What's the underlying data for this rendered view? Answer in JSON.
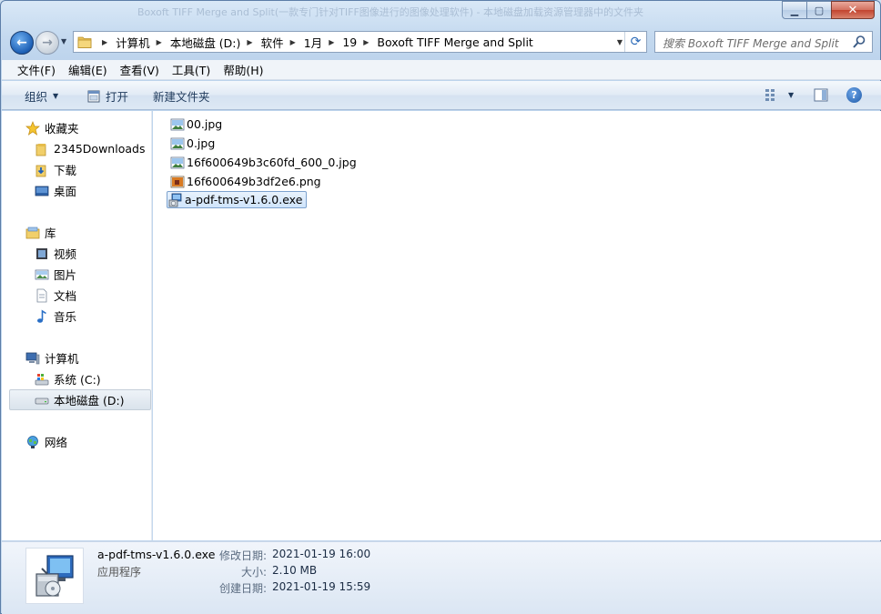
{
  "window": {
    "title": "Boxoft TIFF Merge and Split(一款专门针对TIFF图像进行的图像处理软件) - 本地磁盘加载资源管理器中的文件夹"
  },
  "address": {
    "crumbs": [
      "计算机",
      "本地磁盘 (D:)",
      "软件",
      "1月",
      "19",
      "Boxoft TIFF Merge and Split"
    ]
  },
  "search": {
    "placeholder": "搜索 Boxoft TIFF Merge and Split"
  },
  "menu": {
    "items": [
      "文件(F)",
      "编辑(E)",
      "查看(V)",
      "工具(T)",
      "帮助(H)"
    ]
  },
  "toolbar": {
    "organize_label": "组织",
    "open_label": "打开",
    "newfolder_label": "新建文件夹"
  },
  "sidebar": {
    "favorites": {
      "label": "收藏夹",
      "items": [
        "2345Downloads",
        "下载",
        "桌面"
      ]
    },
    "libraries": {
      "label": "库",
      "items": [
        "视频",
        "图片",
        "文档",
        "音乐"
      ]
    },
    "computer": {
      "label": "计算机",
      "items": [
        "系统 (C:)",
        "本地磁盘 (D:)"
      ]
    },
    "network": {
      "label": "网络"
    }
  },
  "files": [
    {
      "name": "00.jpg",
      "kind": "jpg-icon"
    },
    {
      "name": "0.jpg",
      "kind": "jpg-icon"
    },
    {
      "name": "16f600649b3c60fd_600_0.jpg",
      "kind": "jpg-icon"
    },
    {
      "name": "16f600649b3df2e6.png",
      "kind": "png-icon"
    },
    {
      "name": "a-pdf-tms-v1.6.0.exe",
      "kind": "installer-icon",
      "selected": true
    }
  ],
  "details": {
    "name": "a-pdf-tms-v1.6.0.exe",
    "type": "应用程序",
    "modified_label": "修改日期:",
    "modified_value": "2021-01-19 16:00",
    "size_label": "大小:",
    "size_value": "2.10 MB",
    "created_label": "创建日期:",
    "created_value": "2021-01-19 15:59"
  },
  "colors": {
    "accent": "#1c5fb5",
    "selection_border": "#7da2ce",
    "selection_fill": "#cfe4fb"
  }
}
